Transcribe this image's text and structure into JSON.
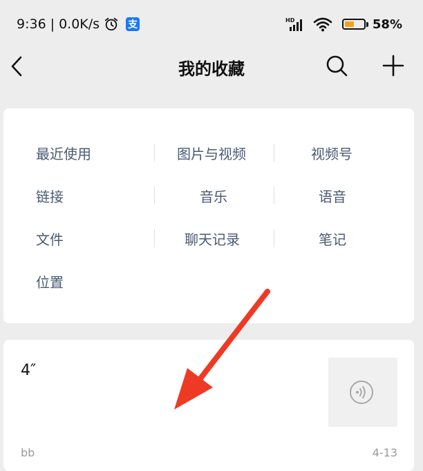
{
  "status_bar": {
    "time": "9:36",
    "network_speed": "0.0K/s",
    "battery_percent": "58%",
    "battery_level": 0.58,
    "icons": [
      "alarm-icon",
      "alipay-icon",
      "hd-signal-icon",
      "wifi-icon",
      "battery-icon"
    ],
    "alipay_glyph": "支",
    "hd_label": "HD"
  },
  "header": {
    "title": "我的收藏",
    "back_icon": "chevron-left-icon",
    "search_icon": "search-icon",
    "add_icon": "plus-icon"
  },
  "categories": {
    "row1": [
      "最近使用",
      "图片与视频",
      "视频号"
    ],
    "row2": [
      "链接",
      "音乐",
      "语音"
    ],
    "row3": [
      "文件",
      "聊天记录",
      "笔记"
    ],
    "row4": [
      "位置"
    ]
  },
  "favorite_item": {
    "duration": "4″",
    "source": "bb",
    "date": "4-13",
    "thumbnail_icon": "voice-icon"
  },
  "colors": {
    "background": "#ededed",
    "category_text": "#4a5a73",
    "annotation_arrow": "#ee3a24",
    "battery": "#f3a21c",
    "alipay": "#1677ff"
  }
}
